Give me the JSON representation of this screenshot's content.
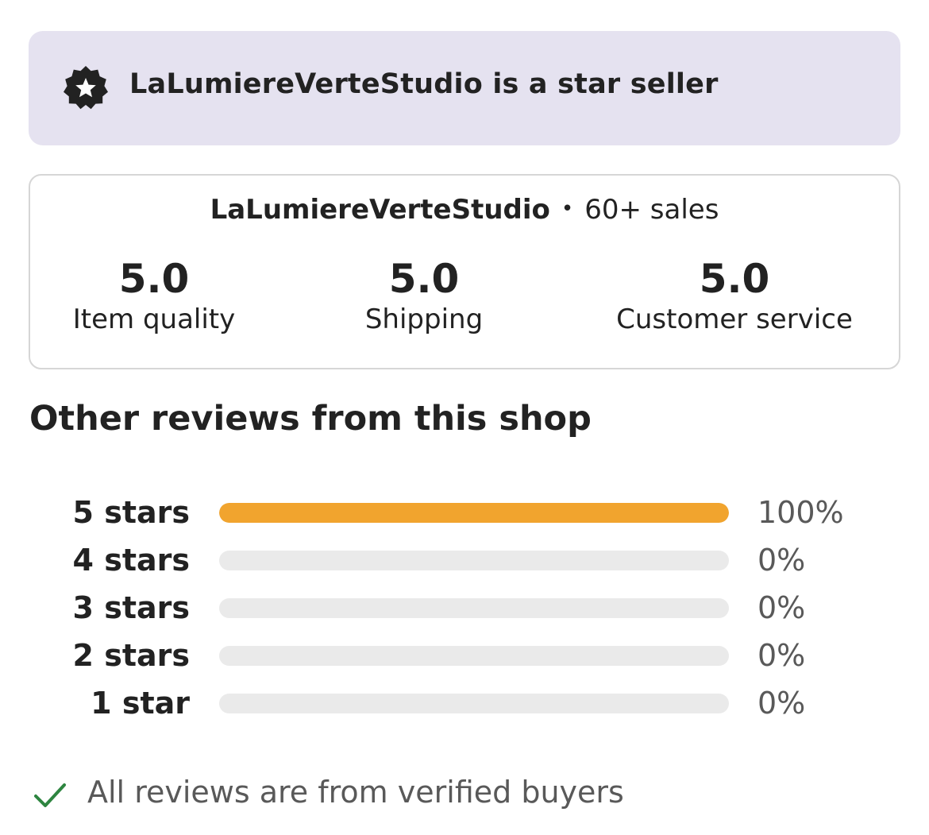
{
  "banner": {
    "text": "LaLumiereVerteStudio is a star seller",
    "icon": "star-seller-badge-icon",
    "background": "#e5e2f0"
  },
  "shop": {
    "name": "LaLumiereVerteStudio",
    "separator": "•",
    "sales": "60+ sales",
    "metrics": [
      {
        "value": "5.0",
        "label": "Item quality"
      },
      {
        "value": "5.0",
        "label": "Shipping"
      },
      {
        "value": "5.0",
        "label": "Customer service"
      }
    ]
  },
  "reviews": {
    "title": "Other reviews from this shop",
    "accent": "#f1a42e",
    "rows": [
      {
        "label": "5 stars",
        "percent_label": "100%",
        "fraction": 1.0
      },
      {
        "label": "4 stars",
        "percent_label": "0%",
        "fraction": 0.0
      },
      {
        "label": "3 stars",
        "percent_label": "0%",
        "fraction": 0.0
      },
      {
        "label": "2 stars",
        "percent_label": "0%",
        "fraction": 0.0
      },
      {
        "label": "1 star",
        "percent_label": "0%",
        "fraction": 0.0
      }
    ]
  },
  "verified": {
    "text": "All reviews are from verified buyers",
    "icon": "checkmark-icon",
    "color": "#2e8540"
  }
}
